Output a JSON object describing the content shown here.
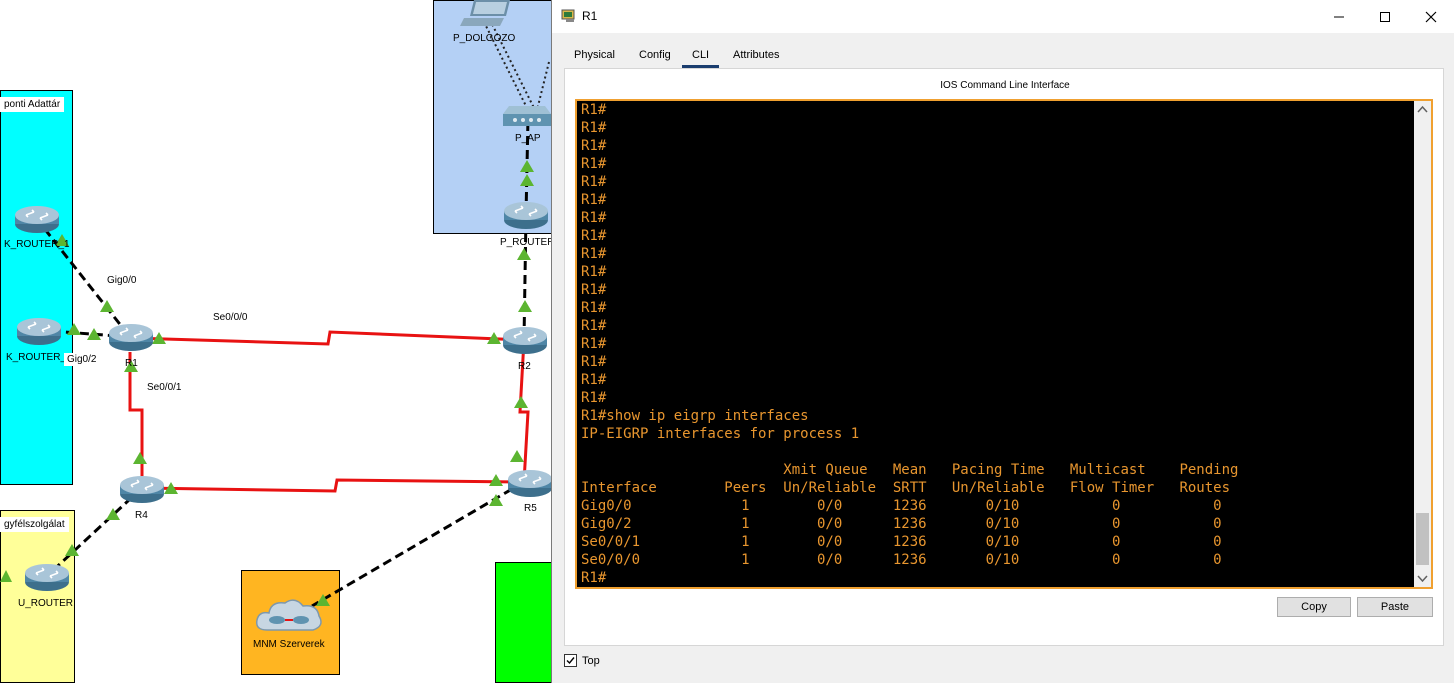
{
  "topology": {
    "areas": {
      "kozponti": "ponti Adattár",
      "ugyfel": "gyfélszolgálat",
      "mnm": "MNM Szerverek"
    },
    "devices": {
      "p_dolgozo": "P_DOLGOZO",
      "p_ap": "P_AP",
      "p_router": "P_ROUTER",
      "k_router_1": "K_ROUTER_1",
      "k_router_2": "K_ROUTER_",
      "r1": "R1",
      "r2": "R2",
      "r4": "R4",
      "r5": "R5",
      "u_router": "U_ROUTER"
    },
    "ports": {
      "gig00": "Gig0/0",
      "gig02": "Gig0/2",
      "se000": "Se0/0/0",
      "se001": "Se0/0/1"
    },
    "colors": {
      "cyan_area": "#00ffff",
      "blue_area": "#b4d0f5",
      "yellow_area": "#ffff99",
      "orange_area": "#ffb521",
      "green_area": "#00ff00",
      "serial_link": "#e81212",
      "link_up": "#5cb531"
    }
  },
  "window": {
    "title": "R1",
    "tabs": [
      "Physical",
      "Config",
      "CLI",
      "Attributes"
    ],
    "active_tab": "CLI",
    "cli_heading": "IOS Command Line Interface",
    "terminal_lines": [
      "R1#",
      "R1#",
      "R1#",
      "R1#",
      "R1#",
      "R1#",
      "R1#",
      "R1#",
      "R1#",
      "R1#",
      "R1#",
      "R1#",
      "R1#",
      "R1#",
      "R1#",
      "R1#",
      "R1#",
      "R1#show ip eigrp interfaces",
      "IP-EIGRP interfaces for process 1",
      "",
      "                        Xmit Queue   Mean   Pacing Time   Multicast    Pending",
      "Interface        Peers  Un/Reliable  SRTT   Un/Reliable   Flow Timer   Routes",
      "Gig0/0             1        0/0      1236       0/10           0           0",
      "Gig0/2             1        0/0      1236       0/10           0           0",
      "Se0/0/1            1        0/0      1236       0/10           0           0",
      "Se0/0/0            1        0/0      1236       0/10           0           0",
      "R1#"
    ],
    "copy_label": "Copy",
    "paste_label": "Paste",
    "top_label": "Top",
    "top_checked": true,
    "terminal_text_color": "#e8962f",
    "terminal_border_color": "#f0a030"
  }
}
